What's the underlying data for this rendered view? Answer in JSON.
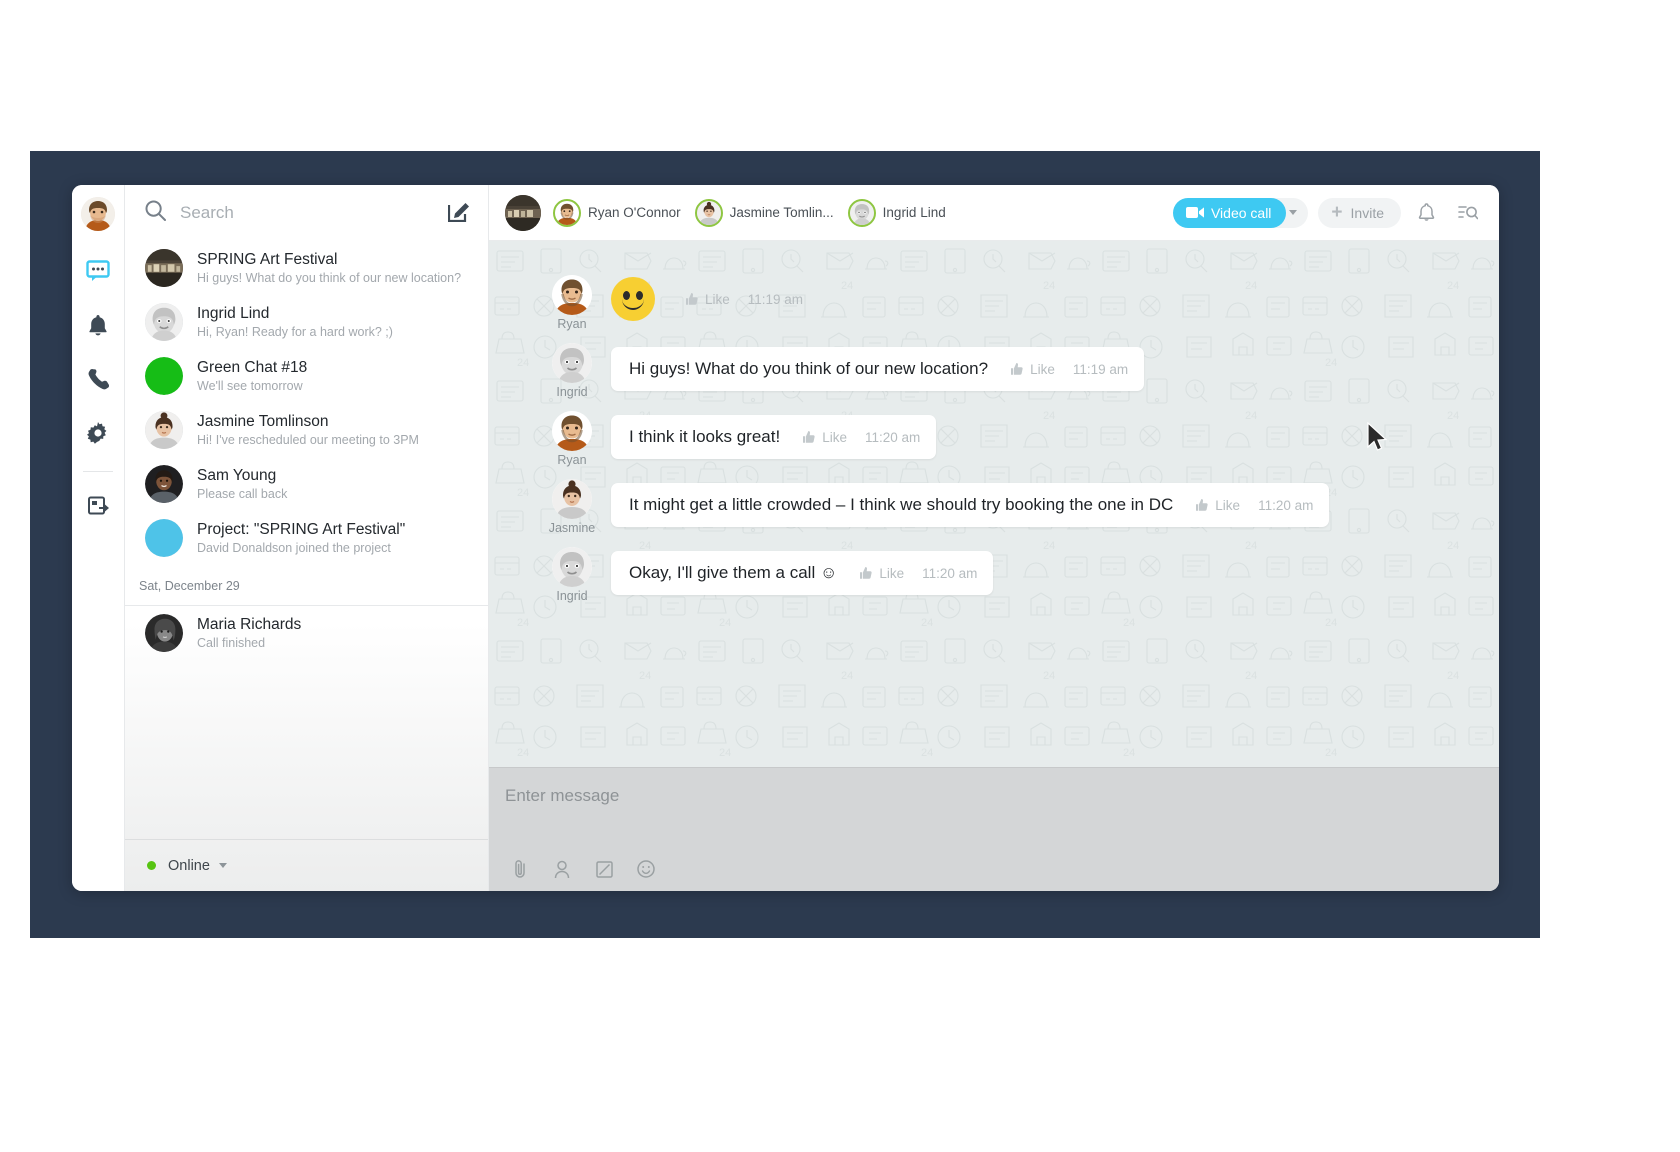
{
  "app": {
    "title": "Messenger",
    "accent": "#3ec9f2",
    "frame_color": "#2c3a4f"
  },
  "rail": {
    "avatar_name": "Ryan O'Connor",
    "items": [
      {
        "icon": "chat-icon",
        "label": "Chat",
        "active": true
      },
      {
        "icon": "bell-icon",
        "label": "Notifications",
        "active": false
      },
      {
        "icon": "phone-icon",
        "label": "Calls",
        "active": false
      },
      {
        "icon": "gear-icon",
        "label": "Settings",
        "active": false
      },
      {
        "icon": "external-window-icon",
        "label": "Open in browser",
        "active": false
      }
    ]
  },
  "search": {
    "placeholder": "Search",
    "value": "",
    "icon": "search-icon"
  },
  "compose": {
    "icon": "compose-icon",
    "label": "New message"
  },
  "chat_list": {
    "items": [
      {
        "name": "SPRING Art Festival",
        "preview": "Hi guys! What do you think of our new location?",
        "avatar": "photo-dark"
      },
      {
        "name": "Ingrid Lind",
        "preview": "Hi, Ryan! Ready for a hard work? ;)",
        "avatar": "ingrid"
      },
      {
        "name": "Green Chat #18",
        "preview": "We'll see tomorrow",
        "avatar": "solid-green",
        "avatar_color": "#16bd16"
      },
      {
        "name": "Jasmine Tomlinson",
        "preview": "Hi! I've rescheduled our meeting to 3PM",
        "avatar": "jasmine"
      },
      {
        "name": "Sam Young",
        "preview": "Please call back",
        "avatar": "sam"
      },
      {
        "name": "Project: \"SPRING Art Festival\"",
        "preview": "David Donaldson joined the project",
        "avatar": "solid-blue",
        "avatar_color": "#4ec3e8"
      }
    ],
    "date_divider": "Sat, December 29",
    "older": [
      {
        "name": "Maria Richards",
        "preview": "Call finished",
        "avatar": "maria"
      }
    ]
  },
  "status": {
    "label": "Online",
    "color": "#57c412"
  },
  "header": {
    "group_avatar": "spring-art-festival",
    "members": [
      {
        "name": "Ryan O'Connor",
        "avatar": "ryan",
        "ring": "#8ec641"
      },
      {
        "name": "Jasmine Tomlin...",
        "avatar": "jasmine",
        "ring": "#8ec641"
      },
      {
        "name": "Ingrid Lind",
        "avatar": "ingrid",
        "ring": "#8ec641"
      }
    ],
    "video_call_label": "Video call",
    "video_call_icon": "video-camera-icon",
    "invite_label": "Invite",
    "invite_icon": "plus-icon",
    "bell_icon": "bell-icon",
    "search_icon": "search-list-icon"
  },
  "messages": [
    {
      "author": "Ryan",
      "avatar": "ryan",
      "type": "sticker",
      "sticker": "smiley-face",
      "like_label": "Like",
      "time": "11:19 am"
    },
    {
      "author": "Ingrid",
      "avatar": "ingrid",
      "type": "text",
      "text": "Hi guys! What do you think of our new location?",
      "like_label": "Like",
      "time": "11:19 am"
    },
    {
      "author": "Ryan",
      "avatar": "ryan",
      "type": "text",
      "text": "I think it looks great!",
      "like_label": "Like",
      "time": "11:20 am"
    },
    {
      "author": "Jasmine",
      "avatar": "jasmine",
      "type": "text",
      "text": "It might get a little crowded – I think we should try booking the one in DC",
      "like_label": "Like",
      "time": "11:20 am"
    },
    {
      "author": "Ingrid",
      "avatar": "ingrid",
      "type": "text",
      "text": "Okay, I'll give them a call ☺",
      "like_label": "Like",
      "time": "11:20 am"
    }
  ],
  "composer": {
    "placeholder": "Enter message",
    "value": "",
    "tools": [
      {
        "icon": "paperclip-icon",
        "label": "Attach file"
      },
      {
        "icon": "mention-user-icon",
        "label": "Mention"
      },
      {
        "icon": "quote-icon",
        "label": "Quote"
      },
      {
        "icon": "emoji-icon",
        "label": "Emoji"
      }
    ]
  }
}
